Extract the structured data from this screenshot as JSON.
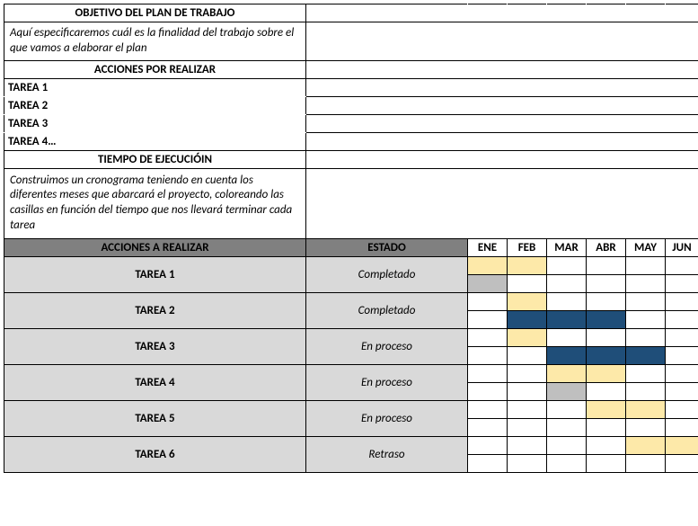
{
  "top": {
    "objetivo_header": "OBJETIVO DEL PLAN DE TRABAJO",
    "objetivo_desc": "Aquí especificaremos cuál es la finalidad del trabajo sobre el que vamos a elaborar el plan",
    "acciones_header": "ACCIONES POR REALIZAR",
    "tareas": [
      "TAREA 1",
      "TAREA 2",
      "TAREA 3",
      "TAREA 4…"
    ],
    "tiempo_header": "TIEMPO DE EJECUCIÓIN",
    "tiempo_desc": "Construimos un cronograma teniendo en cuenta los diferentes meses que abarcará el proyecto, coloreando las casillas en función del tiempo que nos llevará terminar cada tarea"
  },
  "headers": {
    "acciones": "ACCIONES A REALIZAR",
    "estado": "ESTADO",
    "months": [
      "ENE",
      "FEB",
      "MAR",
      "ABR",
      "MAY",
      "JUN"
    ]
  },
  "rows": [
    {
      "name": "TAREA 1",
      "status": "Completado"
    },
    {
      "name": "TAREA 2",
      "status": "Completado"
    },
    {
      "name": "TAREA 3",
      "status": "En proceso"
    },
    {
      "name": "TAREA 4",
      "status": "En proceso"
    },
    {
      "name": "TAREA 5",
      "status": "En proceso"
    },
    {
      "name": "TAREA 6",
      "status": "Retraso"
    }
  ],
  "chart_data": {
    "type": "gantt-table",
    "months": [
      "ENE",
      "FEB",
      "MAR",
      "ABR",
      "MAY",
      "JUN"
    ],
    "legend_colors": {
      "yellow": "#fde9a9",
      "grey": "#bfbfbf",
      "blue": "#1f4e79",
      "none": ""
    },
    "tasks": [
      {
        "name": "TAREA 1",
        "status": "Completado",
        "row1": [
          "yellow",
          "yellow",
          "",
          "",
          "",
          ""
        ],
        "row2": [
          "grey",
          "",
          "",
          "",
          "",
          ""
        ]
      },
      {
        "name": "TAREA 2",
        "status": "Completado",
        "row1": [
          "",
          "yellow",
          "",
          "",
          "",
          ""
        ],
        "row2": [
          "",
          "blue",
          "blue",
          "blue",
          "",
          ""
        ]
      },
      {
        "name": "TAREA 3",
        "status": "En proceso",
        "row1": [
          "",
          "yellow",
          "",
          "",
          "",
          ""
        ],
        "row2": [
          "",
          "",
          "blue",
          "blue",
          "blue",
          ""
        ]
      },
      {
        "name": "TAREA 4",
        "status": "En proceso",
        "row1": [
          "",
          "",
          "yellow",
          "yellow",
          "",
          ""
        ],
        "row2": [
          "",
          "",
          "grey",
          "",
          "",
          ""
        ]
      },
      {
        "name": "TAREA 5",
        "status": "En proceso",
        "row1": [
          "",
          "",
          "",
          "yellow",
          "yellow",
          ""
        ],
        "row2": [
          "",
          "",
          "",
          "",
          "",
          ""
        ]
      },
      {
        "name": "TAREA 6",
        "status": "Retraso",
        "row1": [
          "",
          "",
          "",
          "",
          "yellow",
          "yellow"
        ],
        "row2": [
          "",
          "",
          "",
          "",
          "",
          ""
        ]
      }
    ]
  }
}
